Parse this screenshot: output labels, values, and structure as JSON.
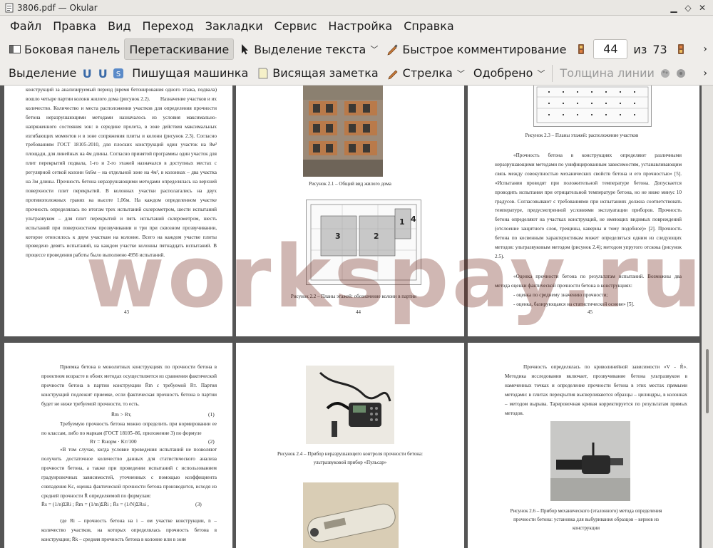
{
  "window": {
    "title": "3806.pdf  — Okular"
  },
  "menu": [
    "Файл",
    "Правка",
    "Вид",
    "Переход",
    "Закладки",
    "Сервис",
    "Настройка",
    "Справка"
  ],
  "toolbar1": {
    "sidebar": "Боковая панель",
    "drag": "Перетаскивание",
    "text_select": "Выделение текста",
    "quick_comment": "Быстрое комментирование",
    "page_current": "44",
    "of_label": "из",
    "page_total": "73"
  },
  "toolbar2": {
    "highlight": "Выделение",
    "typewriter": "Пишущая машинка",
    "sticky_note": "Висящая заметка",
    "arrow": "Стрелка",
    "stamp": "Одобрено",
    "line_width": "Толщина линии"
  },
  "pages": {
    "p43": {
      "text": "конструкций за анализируемый период (время бетонирования одного этажа, подвала) вошло четыре партии колонн жилого дома (рисунок 2.2).        Назначение участков и их количество. Количество и места расположения участков для определения прочности бетона неразрушающими методами назначалось из условия максимально-напряженного состояния зон: в середине пролета, в зоне действия максимальных изгибающих моментов и в зоне сопряжения плиты и колонн (рисунок 2.3). Согласно требованиям ГОСТ 18105-2010, для плоских конструкций один участок на 8м² площади, для линейных на 4м длины. Согласно принятой программы один участок для плит перекрытий подвала, 1-го и 2-го этажей назначался в доступных местах с регулярной сеткой колонн 6х6м – на отдельной зоне на 4м², в колоннах – два участка на 3м длины. Прочность бетона неразрушающими методами определялась на верхней поверхности плит перекрытий. В колоннах участки располагались на двух противоположных гранях на высоте 1,06м. На каждом определенном участке прочность определялась по итогам трех испытаний склерометром, шести испытаний ультразвуком – для плит перекрытий и пять испытаний склерометром, шесть испытаний при поверхностном прозвучивании и три при сквозном прозвучивании, которое относилось к двум участкам на колонне. Всего на каждом участке плиты проведено девять испытаний, на каждом участке колонны пятнадцать испытаний. В процессе проведения работы было выполнено 4956 испытаний.",
      "num": "43"
    },
    "p44": {
      "cap1": "Рисунок 2.1 – Общий вид жилого дома",
      "cap2": "Рисунок 2.2 – Планы этажей: обозначение колонн в партии",
      "num": "44"
    },
    "p45": {
      "cap": "Рисунок 2.3 – Планы этажей: расположение участков",
      "text": "«Прочность бетона в конструкциях определяют различными неразрушающими методами по унифицированным зависимостям, устанавливающим связь между совокупностью механических свойств бетона и его прочностью» [5]. «Испытания проводят при положительной температуре бетона. Допускается проводить испытания при отрицательной температуре бетона, но не ниже минус 10 градусов. Согласовывают с требованиями при испытаниях должна соответствовать температуре, предусмотренной условиями эксплуатации приборов. Прочность бетона определяют на участках конструкций, не имеющих видимых повреждений (отслоение защитного слоя, трещины, каверны и тому подобное)» [2]. Прочность бетона по косвенным характеристикам может определяться одним из следующих методов: ультразвуковым методом (рисунок 2.4); методом упругого отскока (рисунок 2.5).",
      "text2": "«Оценка прочности бетона по результатам испытаний. Возможны два метода оценки фактической прочности бетона в конструкциях:",
      "li1": "- оценка по среднему значению прочности;",
      "li2": "- оценка, базирующаяся на статистической основе» [5].",
      "num": "45"
    },
    "p46": {
      "text": "Приемка бетона в монолитных конструкциях по прочности бетона в проектном возрасте в обоих методах осуществляется из сравнения фактической прочности бетона в партии конструкции R̄m с требуемой Rт. Партия конструкций подлежит приемке, если фактическая прочность бетона в партии будет не ниже требуемой прочности, то есть.",
      "f1": "R̄m > Rт,",
      "f1n": "(1)",
      "text2": "Требуемую прочность бетона можно определить при нормировании ее по классам, либо по маркам (ГОСТ 18105–86, приложение 3) по формуле",
      "f2": "Rт = Rнорм · Kт/100",
      "f2n": "(2)",
      "text3": "«В том случае, когда условие проведения испытаний не позволяют получить достаточное количество данных для статистического анализа прочности бетона, а также при проведении испытаний с использованием градуировочных зависимостей, уточненных с помощью коэффициента совпадения Kс, оценка фактической прочности бетона производится, исходя из средней прочности R̄ определяемой по формулам:",
      "f3": "R̄s = (1/n)ΣRi ; R̄m = (1/m)ΣR̄i ; R̄s = (1/N)ΣRsi ,",
      "f3n": "(3)",
      "text4": "где Ri – прочность бетона на i – ом участке конструкции, n – количество участков, на которых определялась прочность бетона в конструкции; R̄k – средняя прочность бетона в колонне или в зоне"
    },
    "p47": {
      "cap": "Рисунок 2.4 – Прибор неразрушающего контроля прочности бетона: ультразвуковой прибор «Пульсар»"
    },
    "p48": {
      "text": "Прочность определялась по криволинейной зависимости «V - R̂». Методика исследования включает, прозвучивание бетона ультразвуком в намеченных точках и определение прочности бетона в этих местах прямыми методами: в плитах перекрытия высверливаются образцы – цилиндры, в колоннах – методом вырыва. Тарировочная кривая корректируется по результатам прямых методов.",
      "cap": "Рисунок 2.6 – Прибор механического (эталонного) метода определения прочности бетона: установка для выбуривания образцов – кернов из конструкции"
    }
  },
  "watermark": "workspay.ru"
}
